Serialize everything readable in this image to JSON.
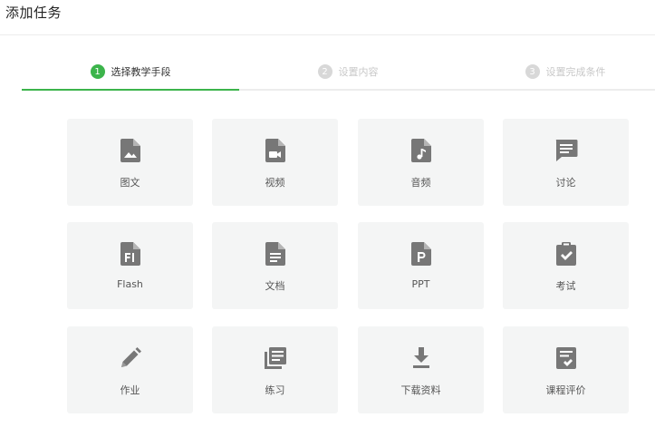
{
  "header": {
    "title": "添加任务"
  },
  "steps": [
    {
      "number": "1",
      "label": "选择教学手段",
      "state": "active"
    },
    {
      "number": "2",
      "label": "设置内容",
      "state": "inactive"
    },
    {
      "number": "3",
      "label": "设置完成条件",
      "state": "inactive"
    }
  ],
  "colors": {
    "accent": "#3cb44b",
    "icon": "#777777",
    "tile_bg": "#f4f5f5"
  },
  "options": [
    {
      "label": "图文",
      "icon": "image-file-icon"
    },
    {
      "label": "视频",
      "icon": "video-file-icon"
    },
    {
      "label": "音频",
      "icon": "audio-file-icon"
    },
    {
      "label": "讨论",
      "icon": "chat-icon"
    },
    {
      "label": "Flash",
      "icon": "flash-file-icon"
    },
    {
      "label": "文档",
      "icon": "document-icon"
    },
    {
      "label": "PPT",
      "icon": "ppt-file-icon"
    },
    {
      "label": "考试",
      "icon": "exam-clipboard-icon"
    },
    {
      "label": "作业",
      "icon": "pencil-icon"
    },
    {
      "label": "练习",
      "icon": "exercise-list-icon"
    },
    {
      "label": "下载资料",
      "icon": "download-icon"
    },
    {
      "label": "课程评价",
      "icon": "evaluation-icon"
    }
  ]
}
